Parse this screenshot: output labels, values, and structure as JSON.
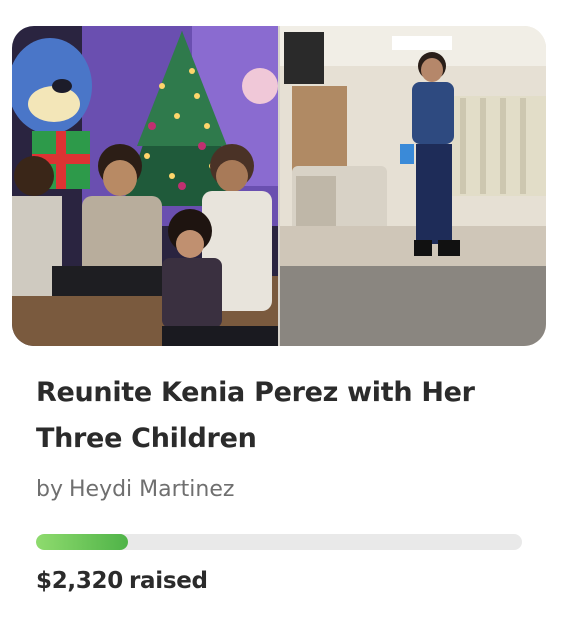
{
  "campaign": {
    "title": "Reunite Kenia Perez with Her Three Children",
    "organizer_prefix": "by",
    "organizer_name": "Heydi Martinez",
    "raised_amount": "$2,320",
    "raised_suffix": "raised",
    "progress_fraction": 0.19,
    "progress_color": "#5fbf4f"
  },
  "hero_image": {
    "left_photo": "family-with-christmas-tree",
    "right_photo": "woman-in-hospital-room"
  }
}
